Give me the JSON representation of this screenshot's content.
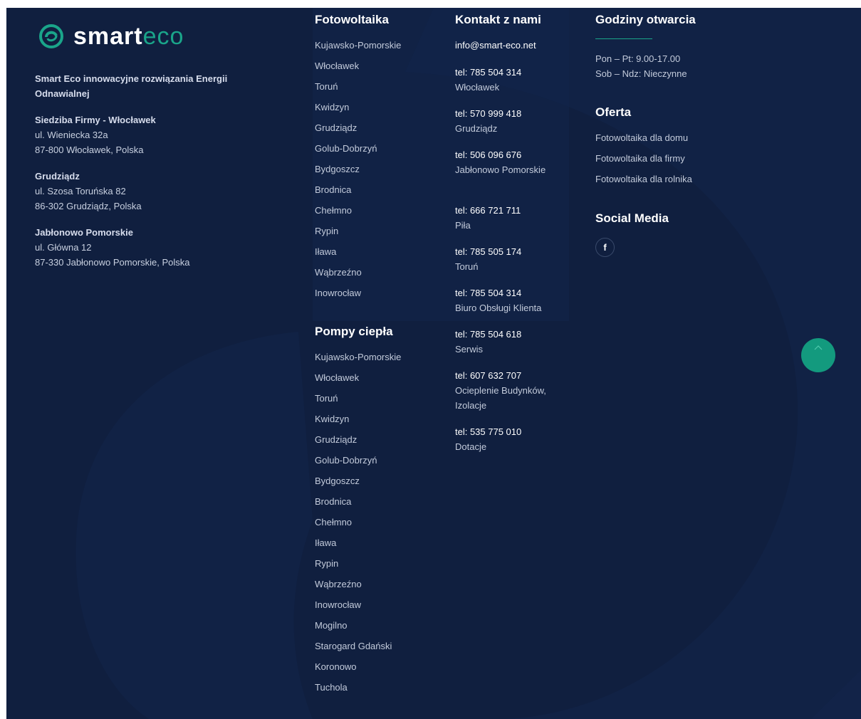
{
  "brand": {
    "logo_text_a": "smart",
    "logo_text_b": "eco",
    "accent_color": "#1aa58a",
    "background_color": "#101f3f"
  },
  "company": {
    "tagline": "Smart Eco innowacyjne rozwiązania Energii Odnawialnej",
    "locations": [
      {
        "title": "Siedziba Firmy - Włocławek",
        "line1": "ul. Wieniecka 32a",
        "line2": "87-800 Włocławek, Polska"
      },
      {
        "title": "Grudziądz",
        "line1": "ul. Szosa Toruńska 82",
        "line2": "86-302 Grudziądz, Polska"
      },
      {
        "title": "Jabłonowo Pomorskie",
        "line1": "ul. Główna 12",
        "line2": "87-330 Jabłonowo Pomorskie, Polska"
      }
    ]
  },
  "fotowoltaika": {
    "heading": "Fotowoltaika",
    "items": [
      "Kujawsko-Pomorskie",
      "Włocławek",
      "Toruń",
      "Kwidzyn",
      "Grudziądz",
      "Golub-Dobrzyń",
      "Bydgoszcz",
      "Brodnica",
      "Chełmno",
      "Rypin",
      "Iława",
      "Wąbrzeźno",
      "Inowrocław"
    ]
  },
  "pompy": {
    "heading": "Pompy ciepła",
    "items": [
      "Kujawsko-Pomorskie",
      "Włocławek",
      "Toruń",
      "Kwidzyn",
      "Grudziądz",
      "Golub-Dobrzyń",
      "Bydgoszcz",
      "Brodnica",
      "Chełmno",
      "Iława",
      "Rypin",
      "Wąbrzeźno",
      "Inowrocław",
      "Mogilno",
      "Starogard Gdański",
      "Koronowo",
      "Tuchola"
    ]
  },
  "kontakt": {
    "heading": "Kontakt z nami",
    "email": "info@smart-eco.net",
    "entries": [
      {
        "tel": "tel: 785 504 314",
        "desc": "Włocławek"
      },
      {
        "tel": "tel: 570 999 418",
        "desc": "Grudziądz"
      },
      {
        "tel": "tel: 506 096 676",
        "desc": "Jabłonowo Pomorskie"
      },
      {
        "tel": "tel: 666 721 711",
        "desc": "Piła"
      },
      {
        "tel": "tel: 785 505 174",
        "desc": "Toruń"
      },
      {
        "tel": "tel: 785 504 314",
        "desc": "Biuro Obsługi Klienta"
      },
      {
        "tel": "tel: 785 504 618",
        "desc": "Serwis"
      },
      {
        "tel": "tel: 607 632 707",
        "desc": "Ocieplenie Budynków, Izolacje"
      },
      {
        "tel": "tel: 535 775 010",
        "desc": "Dotacje"
      }
    ]
  },
  "godziny": {
    "heading": "Godziny otwarcia",
    "weekdays": "Pon – Pt: 9.00-17.00",
    "weekend": "Sob – Ndz: Nieczynne"
  },
  "oferta": {
    "heading": "Oferta",
    "items": [
      "Fotowoltaika dla domu",
      "Fotowoltaika dla firmy",
      "Fotowoltaika dla rolnika"
    ]
  },
  "social": {
    "heading": "Social Media",
    "facebook_glyph": "f",
    "icons": [
      "facebook-icon"
    ]
  },
  "scroll_top": {
    "icon": "chevron-up-icon"
  }
}
